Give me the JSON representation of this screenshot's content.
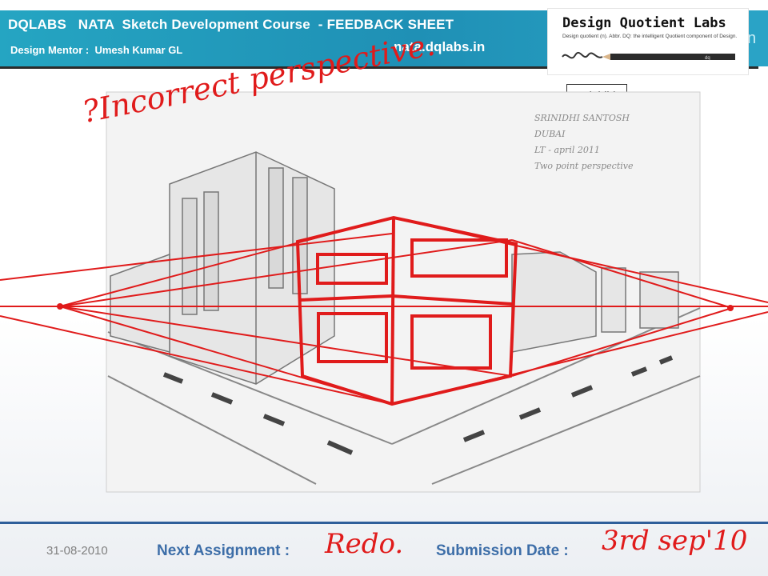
{
  "header": {
    "title": "DQLABS   NATA  Sketch Development Course  - FEEDBACK SHEET",
    "mentor": "Design Mentor :  Umesh Kumar GL",
    "website": "nata.dqlabs.in",
    "bg_color": "#1f90b5"
  },
  "logo": {
    "title": "Design Quotient Labs",
    "tagline": "Design quotient (n). Abbr. DQ: the intelligent Quotient component of Design.",
    "pencil_mark": "dq"
  },
  "student": {
    "name": "Srinidhi"
  },
  "sketch": {
    "annotation": "?Incorrect perspective.",
    "student_note": [
      "SRINIDHI SANTOSH",
      "DUBAI",
      "LT - april 2011",
      "Two point perspective"
    ],
    "correction_color": "#e01b1b"
  },
  "footer": {
    "date": "31-08-2010",
    "next_assignment_label": "Next Assignment  :",
    "next_assignment_value": "Redo.",
    "submission_date_label": "Submission Date  :",
    "submission_date_value": "3rd sep'10"
  }
}
